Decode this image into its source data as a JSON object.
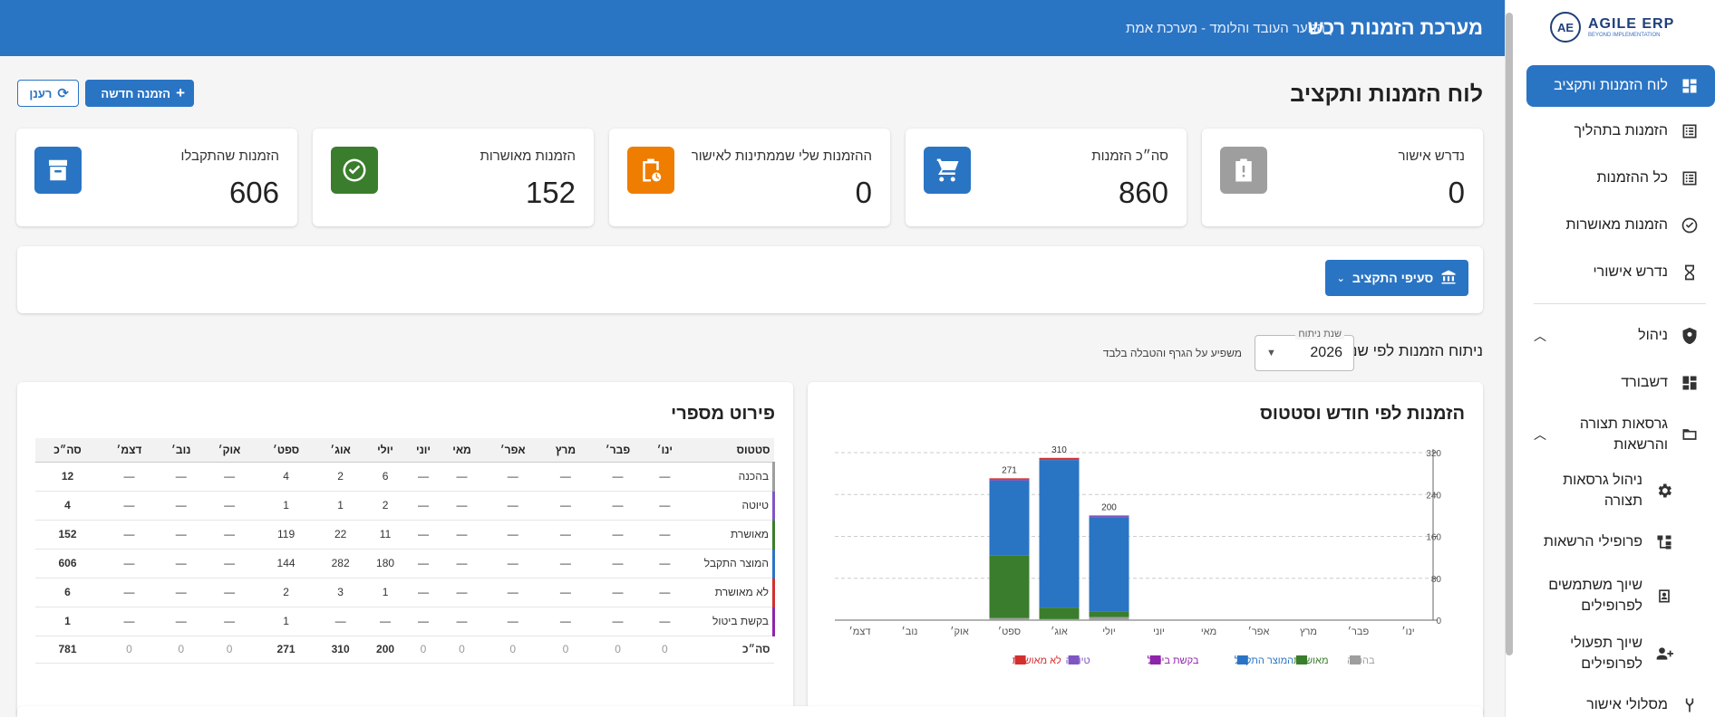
{
  "header": {
    "title": "מערכת הזמנות רכש",
    "subtitle": "| הנוער העובד והלומד - מערכת אמת"
  },
  "logo": {
    "mark": "AE",
    "name": "AGILE ERP",
    "tagline": "BEYOND IMPLEMENTATION"
  },
  "sidebar": {
    "items": [
      {
        "label": "לוח הזמנות ותקציב",
        "icon": "dashboard-icon"
      },
      {
        "label": "הזמנות בתהליך",
        "icon": "list-icon"
      },
      {
        "label": "כל ההזמנות",
        "icon": "list-icon"
      },
      {
        "label": "הזמנות מאושרות",
        "icon": "check-circle-icon"
      },
      {
        "label": "נדרש אישורי",
        "icon": "hourglass-icon"
      },
      {
        "label": "ניהול",
        "icon": "admin-icon"
      },
      {
        "label": "דשבורד",
        "icon": "dashboard-icon"
      },
      {
        "label": "גרסאות תצורה והרשאות",
        "icon": "folder-icon"
      },
      {
        "label": "ניהול גרסאות תצורה",
        "icon": "settings-icon"
      },
      {
        "label": "פרופילי הרשאות",
        "icon": "tree-icon"
      },
      {
        "label": "שיוך משתמשים לפרופילים",
        "icon": "badge-icon"
      },
      {
        "label": "שיוך תפעולי לפרופילים",
        "icon": "person-add-icon"
      },
      {
        "label": "מסלולי אישור",
        "icon": "fork-icon"
      }
    ]
  },
  "page": {
    "title": "לוח הזמנות ותקציב",
    "new_order": "הזמנה חדשה",
    "refresh": "רענן"
  },
  "stats": [
    {
      "label": "נדרש אישור",
      "value": "0",
      "color": "#9e9e9e",
      "icon": "clipboard-alert-icon"
    },
    {
      "label": "סה״כ הזמנות",
      "value": "860",
      "color": "#2a74c4",
      "icon": "cart-icon"
    },
    {
      "label": "ההזמנות שלי שממתינות לאישור",
      "value": "0",
      "color": "#ef7d00",
      "icon": "clipboard-clock-icon"
    },
    {
      "label": "הזמנות מאושרות",
      "value": "152",
      "color": "#3a7d2c",
      "icon": "check-circle-icon"
    },
    {
      "label": "הזמנות שהתקבלו",
      "value": "606",
      "color": "#2a74c4",
      "icon": "archive-icon"
    }
  ],
  "budget": {
    "label": "סעיפי התקציב"
  },
  "analysis": {
    "label": "ניתוח הזמנות לפי שנה",
    "year_legend": "שנת ניתוח",
    "year": "2026",
    "note": "משפיע על הגרף והטבלה בלבד"
  },
  "chart_panel": {
    "title": "הזמנות לפי חודש וסטטוס"
  },
  "table_panel": {
    "title": "פירוט מספרי"
  },
  "chart_data": {
    "type": "bar",
    "stacked": true,
    "categories": [
      "ינו׳",
      "פבר׳",
      "מרץ",
      "אפר׳",
      "מאי",
      "יוני",
      "יולי",
      "אוג׳",
      "ספט׳",
      "אוק׳",
      "נוב׳",
      "דצמ׳"
    ],
    "ylim": [
      0,
      320
    ],
    "yticks": [
      0,
      80,
      160,
      240,
      320
    ],
    "grid": true,
    "legend_position": "bottom",
    "totals": [
      0,
      0,
      0,
      0,
      0,
      0,
      200,
      310,
      271,
      0,
      0,
      0
    ],
    "series": [
      {
        "name": "בהכנה",
        "color": "#9e9e9e",
        "values": [
          0,
          0,
          0,
          0,
          0,
          0,
          6,
          2,
          4,
          0,
          0,
          0
        ]
      },
      {
        "name": "מאושרת",
        "color": "#3a7d2c",
        "values": [
          0,
          0,
          0,
          0,
          0,
          0,
          11,
          22,
          119,
          0,
          0,
          0
        ]
      },
      {
        "name": "המוצר התקבל",
        "color": "#2a74c4",
        "values": [
          0,
          0,
          0,
          0,
          0,
          0,
          180,
          282,
          144,
          0,
          0,
          0
        ]
      },
      {
        "name": "בקשת ביטול",
        "color": "#8e24aa",
        "values": [
          0,
          0,
          0,
          0,
          0,
          0,
          0,
          0,
          1,
          0,
          0,
          0
        ]
      },
      {
        "name": "טיוטה",
        "color": "#7e57c2",
        "values": [
          0,
          0,
          0,
          0,
          0,
          0,
          2,
          1,
          1,
          0,
          0,
          0
        ]
      },
      {
        "name": "לא מאושרת",
        "color": "#d32f2f",
        "values": [
          0,
          0,
          0,
          0,
          0,
          0,
          1,
          3,
          2,
          0,
          0,
          0
        ]
      }
    ]
  },
  "table": {
    "headers": [
      "סטטוס",
      "ינו׳",
      "פבר׳",
      "מרץ",
      "אפר׳",
      "מאי",
      "יוני",
      "יולי",
      "אוג׳",
      "ספט׳",
      "אוק׳",
      "נוב׳",
      "דצמ׳",
      "סה״כ"
    ],
    "rows": [
      {
        "status": "בהכנה",
        "accent": "#9e9e9e",
        "cells": [
          "—",
          "—",
          "—",
          "—",
          "—",
          "—",
          "6",
          "2",
          "4",
          "—",
          "—",
          "—"
        ],
        "total": "12"
      },
      {
        "status": "טיוטה",
        "accent": "#7e57c2",
        "cells": [
          "—",
          "—",
          "—",
          "—",
          "—",
          "—",
          "2",
          "1",
          "1",
          "—",
          "—",
          "—"
        ],
        "total": "4"
      },
      {
        "status": "מאושרת",
        "accent": "#3a7d2c",
        "cells": [
          "—",
          "—",
          "—",
          "—",
          "—",
          "—",
          "11",
          "22",
          "119",
          "—",
          "—",
          "—"
        ],
        "total": "152"
      },
      {
        "status": "המוצר התקבל",
        "accent": "#2a74c4",
        "cells": [
          "—",
          "—",
          "—",
          "—",
          "—",
          "—",
          "180",
          "282",
          "144",
          "—",
          "—",
          "—"
        ],
        "total": "606"
      },
      {
        "status": "לא מאושרת",
        "accent": "#d32f2f",
        "cells": [
          "—",
          "—",
          "—",
          "—",
          "—",
          "—",
          "1",
          "3",
          "2",
          "—",
          "—",
          "—"
        ],
        "total": "6"
      },
      {
        "status": "בקשת ביטול",
        "accent": "#8e24aa",
        "cells": [
          "—",
          "—",
          "—",
          "—",
          "—",
          "—",
          "—",
          "—",
          "1",
          "—",
          "—",
          "—"
        ],
        "total": "1"
      }
    ],
    "total_row": {
      "label": "סה״כ",
      "cells": [
        "0",
        "0",
        "0",
        "0",
        "0",
        "0",
        "200",
        "310",
        "271",
        "0",
        "0",
        "0"
      ],
      "total": "781"
    }
  }
}
